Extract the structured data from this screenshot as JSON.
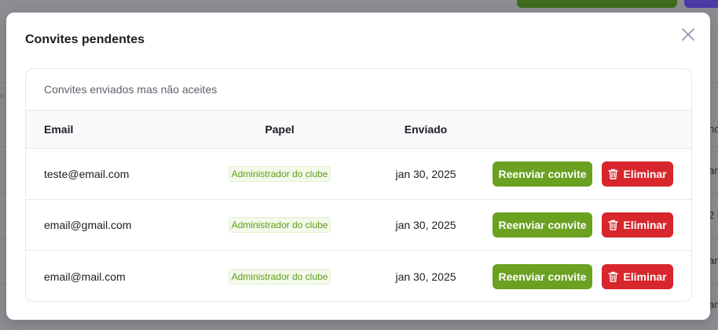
{
  "modal": {
    "title": "Convites pendentes",
    "description": "Convites enviados mas não aceites"
  },
  "table": {
    "headers": {
      "email": "Email",
      "role": "Papel",
      "sent": "Enviado"
    },
    "rows": [
      {
        "email": "teste@email.com",
        "role": "Administrador do clube",
        "sent": "jan 30, 2025",
        "resend_label": "Reenviar convite",
        "delete_label": "Eliminar"
      },
      {
        "email": "email@gmail.com",
        "role": "Administrador do clube",
        "sent": "jan 30, 2025",
        "resend_label": "Reenviar convite",
        "delete_label": "Eliminar"
      },
      {
        "email": "email@mail.com",
        "role": "Administrador do clube",
        "sent": "jan 30, 2025",
        "resend_label": "Reenviar convite",
        "delete_label": "Eliminar"
      }
    ]
  },
  "background": {
    "edge_fragments": [
      "no",
      "an",
      "2 r",
      "an",
      "an"
    ],
    "left_fragment": "o"
  },
  "icons": {
    "close": "close-icon",
    "trash": "trash-icon"
  },
  "colors": {
    "resend": "#6aa121",
    "delete": "#d7262c",
    "badge_text": "#5e9c1c"
  }
}
